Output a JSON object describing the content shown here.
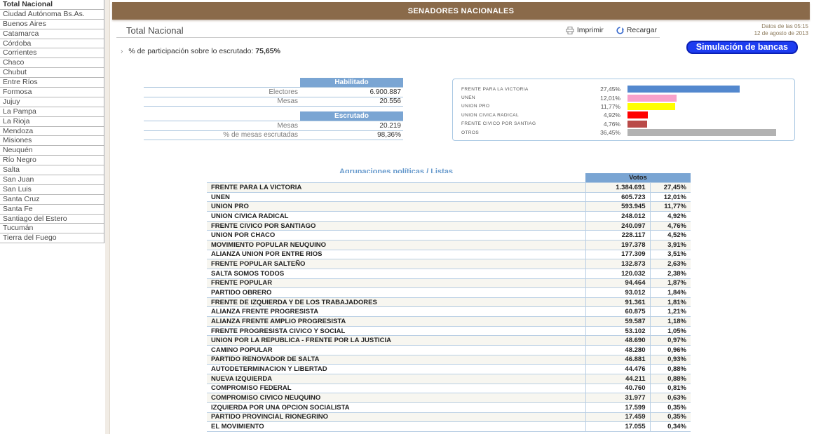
{
  "sidebar": {
    "items": [
      "Total Nacional",
      "Ciudad Autónoma Bs.As.",
      "Buenos Aires",
      "Catamarca",
      "Córdoba",
      "Corrientes",
      "Chaco",
      "Chubut",
      "Entre Ríos",
      "Formosa",
      "Jujuy",
      "La Pampa",
      "La Rioja",
      "Mendoza",
      "Misiones",
      "Neuquén",
      "Río Negro",
      "Salta",
      "San Juan",
      "San Luis",
      "Santa Cruz",
      "Santa Fe",
      "Santiago del Estero",
      "Tucumán",
      "Tierra del Fuego"
    ]
  },
  "header": {
    "title": "SENADORES NACIONALES"
  },
  "toolbar": {
    "page_title": "Total Nacional",
    "print_label": "Imprimir",
    "reload_label": "Recargar"
  },
  "datebox": {
    "line1": "Datos de las 05:15",
    "line2": "12 de agosto de 2013"
  },
  "simulation_button": {
    "label": "Simulación de bancas"
  },
  "participation": {
    "label": "% de participación sobre lo escrutado:",
    "value": "75,65%"
  },
  "habilitado": {
    "header": "Habilitado",
    "rows": [
      [
        "Electores",
        "6.900.887"
      ],
      [
        "Mesas",
        "20.556"
      ]
    ]
  },
  "escrutado": {
    "header": "Escrutado",
    "rows": [
      [
        "Mesas",
        "20.219"
      ],
      [
        "% de mesas escrutadas",
        "98,36%"
      ]
    ]
  },
  "chart_data": {
    "type": "bar",
    "orientation": "horizontal",
    "categories": [
      "FRENTE PARA LA VICTORIA",
      "UNEN",
      "UNION PRO",
      "UNION CIVICA RADICAL",
      "FRENTE CIVICO POR SANTIAG",
      "OTROS"
    ],
    "values": [
      27.45,
      12.01,
      11.77,
      4.92,
      4.76,
      36.45
    ],
    "value_labels": [
      "27,45%",
      "12,01%",
      "11,77%",
      "4,92%",
      "4,76%",
      "36,45%"
    ],
    "colors": [
      "#5388ce",
      "#f9a1cb",
      "#ffff00",
      "#ff0000",
      "#b94a48",
      "#b2b2b2"
    ],
    "xlim": [
      0,
      36.45
    ],
    "title": "",
    "xlabel": "",
    "ylabel": ""
  },
  "results_table": {
    "title": "Agrupaciones políticas / Listas",
    "votes_header": "Votos",
    "rows": [
      [
        "FRENTE PARA LA VICTORIA",
        "1.384.691",
        "27,45%"
      ],
      [
        "UNEN",
        "605.723",
        "12,01%"
      ],
      [
        "UNION PRO",
        "593.945",
        "11,77%"
      ],
      [
        "UNION CIVICA RADICAL",
        "248.012",
        "4,92%"
      ],
      [
        "FRENTE CIVICO POR SANTIAGO",
        "240.097",
        "4,76%"
      ],
      [
        "UNION POR CHACO",
        "228.117",
        "4,52%"
      ],
      [
        "MOVIMIENTO POPULAR NEUQUINO",
        "197.378",
        "3,91%"
      ],
      [
        "ALIANZA UNION POR ENTRE RIOS",
        "177.309",
        "3,51%"
      ],
      [
        "FRENTE POPULAR SALTEÑO",
        "132.873",
        "2,63%"
      ],
      [
        "SALTA SOMOS TODOS",
        "120.032",
        "2,38%"
      ],
      [
        "FRENTE POPULAR",
        "94.464",
        "1,87%"
      ],
      [
        "PARTIDO OBRERO",
        "93.012",
        "1,84%"
      ],
      [
        "FRENTE DE IZQUIERDA Y DE LOS TRABAJADORES",
        "91.361",
        "1,81%"
      ],
      [
        "ALIANZA FRENTE PROGRESISTA",
        "60.875",
        "1,21%"
      ],
      [
        "ALIANZA FRENTE AMPLIO PROGRESISTA",
        "59.587",
        "1,18%"
      ],
      [
        "FRENTE PROGRESISTA CIVICO Y SOCIAL",
        "53.102",
        "1,05%"
      ],
      [
        "UNION POR LA REPUBLICA - FRENTE POR LA JUSTICIA",
        "48.690",
        "0,97%"
      ],
      [
        "CAMINO POPULAR",
        "48.280",
        "0,96%"
      ],
      [
        "PARTIDO RENOVADOR DE SALTA",
        "46.881",
        "0,93%"
      ],
      [
        "AUTODETERMINACION Y LIBERTAD",
        "44.476",
        "0,88%"
      ],
      [
        "NUEVA IZQUIERDA",
        "44.211",
        "0,88%"
      ],
      [
        "COMPROMISO FEDERAL",
        "40.760",
        "0,81%"
      ],
      [
        "COMPROMISO CIVICO NEUQUINO",
        "31.977",
        "0,63%"
      ],
      [
        "IZQUIERDA POR UNA OPCION SOCIALISTA",
        "17.599",
        "0,35%"
      ],
      [
        "PARTIDO PROVINCIAL RIONEGRINO",
        "17.459",
        "0,35%"
      ],
      [
        "EL MOVIMIENTO",
        "17.055",
        "0,34%"
      ]
    ]
  }
}
